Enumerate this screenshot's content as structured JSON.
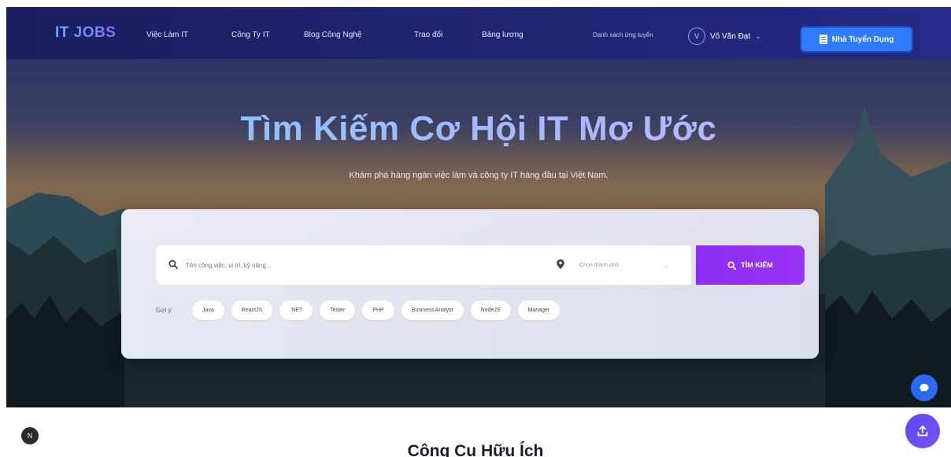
{
  "nav": {
    "logo": "IT JOBS",
    "links": [
      "Việc Làm IT",
      "Công Ty IT",
      "Blog Công Nghệ",
      "Trao đổi",
      "Bảng lương"
    ],
    "saved_link": "Danh sách ứng tuyển",
    "user_initial": "V",
    "user_name": "Võ Văn Đạt",
    "employer_button": "Nhà Tuyển Dụng"
  },
  "hero": {
    "title": "Tìm Kiếm Cơ Hội IT Mơ Ước",
    "subtitle": "Khám phá hàng ngàn việc làm và công ty IT hàng đầu tại Việt Nam."
  },
  "search": {
    "placeholder": "Tên công việc, vị trí, kỹ năng...",
    "city_placeholder": "Chọn thành phố",
    "button_label": "TÌM KIẾM",
    "suggest_label": "Gợi ý:",
    "tags": [
      "Java",
      "ReactJS",
      ".NET",
      "Tester",
      "PHP",
      "Business Analyst",
      "NodeJS",
      "Manager"
    ]
  },
  "floating": {
    "left_badge": "N"
  },
  "section": {
    "title": "Công Cụ Hữu Ích"
  },
  "colors": {
    "nav_bg": "#1f2470",
    "accent_blue": "#2f7bff",
    "search_purple": "#8a2df0",
    "fab_blue": "#2d68f2",
    "fab_purple": "#6a4ef2"
  },
  "icons": [
    "search-icon",
    "location-pin-icon",
    "chevron-down-icon",
    "document-icon",
    "chat-icon",
    "upload-icon"
  ]
}
